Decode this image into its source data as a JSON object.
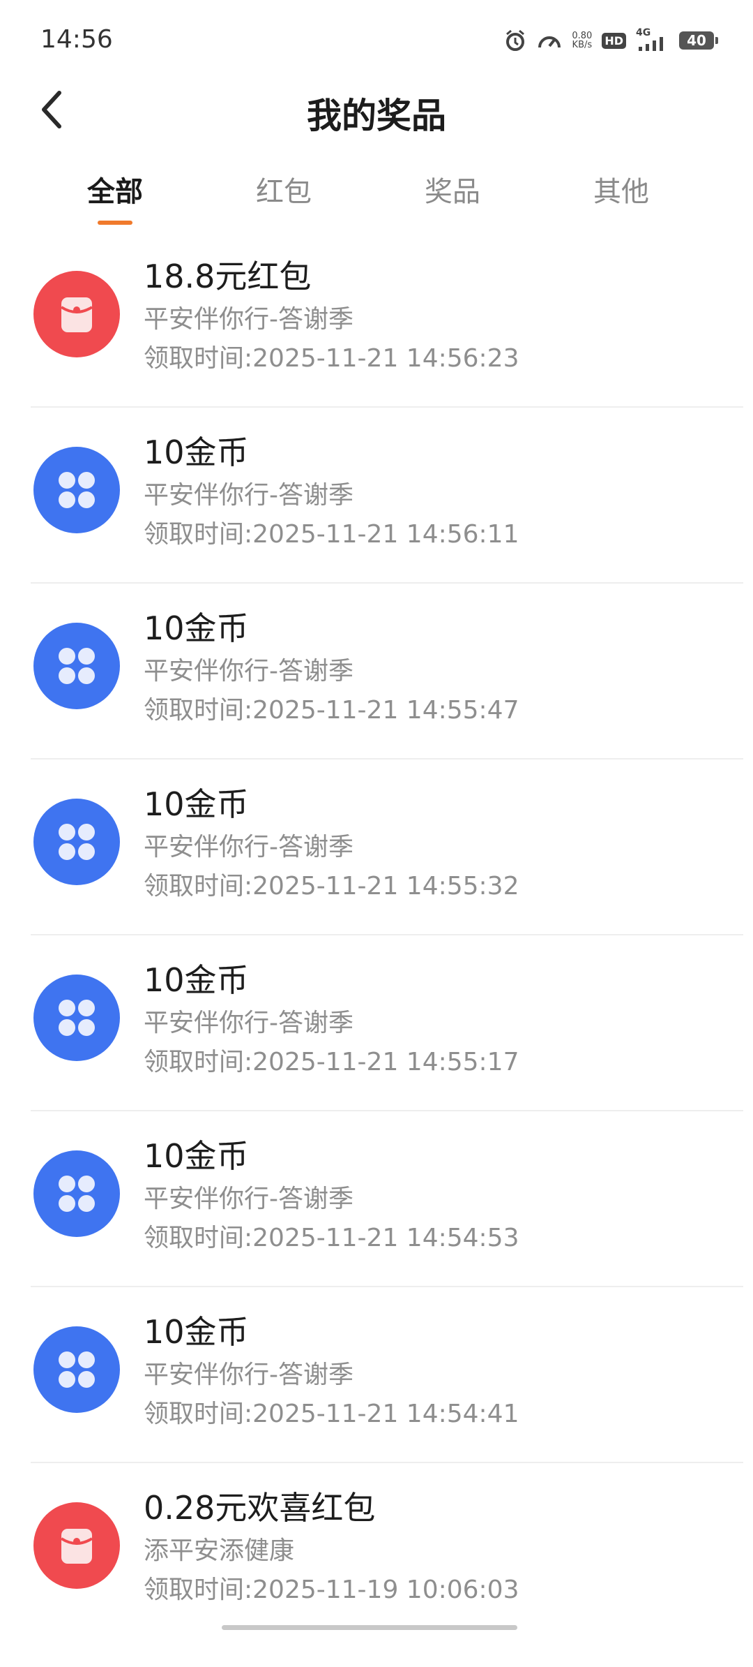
{
  "status_bar": {
    "time": "14:56",
    "net_speed_value": "0.80",
    "net_speed_unit": "KB/s",
    "hd_label": "HD",
    "network_label": "4G",
    "battery_level": "40"
  },
  "header": {
    "title": "我的奖品"
  },
  "tabs": [
    {
      "label": "全部",
      "active": true
    },
    {
      "label": "红包",
      "active": false
    },
    {
      "label": "奖品",
      "active": false
    },
    {
      "label": "其他",
      "active": false
    }
  ],
  "colors": {
    "tab_indicator": "#f07a2c",
    "red_icon": "#f04a4f",
    "blue_icon": "#3f74f0"
  },
  "items": [
    {
      "icon": "red-envelope-icon",
      "title": "18.8元红包",
      "source": "平安伴你行-答谢季",
      "time": "领取时间:2025-11-21 14:56:23"
    },
    {
      "icon": "coin-clover-icon",
      "title": "10金币",
      "source": "平安伴你行-答谢季",
      "time": "领取时间:2025-11-21 14:56:11"
    },
    {
      "icon": "coin-clover-icon",
      "title": "10金币",
      "source": "平安伴你行-答谢季",
      "time": "领取时间:2025-11-21 14:55:47"
    },
    {
      "icon": "coin-clover-icon",
      "title": "10金币",
      "source": "平安伴你行-答谢季",
      "time": "领取时间:2025-11-21 14:55:32"
    },
    {
      "icon": "coin-clover-icon",
      "title": "10金币",
      "source": "平安伴你行-答谢季",
      "time": "领取时间:2025-11-21 14:55:17"
    },
    {
      "icon": "coin-clover-icon",
      "title": "10金币",
      "source": "平安伴你行-答谢季",
      "time": "领取时间:2025-11-21 14:54:53"
    },
    {
      "icon": "coin-clover-icon",
      "title": "10金币",
      "source": "平安伴你行-答谢季",
      "time": "领取时间:2025-11-21 14:54:41"
    },
    {
      "icon": "red-envelope-icon",
      "title": "0.28元欢喜红包",
      "source": "添平安添健康",
      "time": "领取时间:2025-11-19 10:06:03"
    }
  ]
}
